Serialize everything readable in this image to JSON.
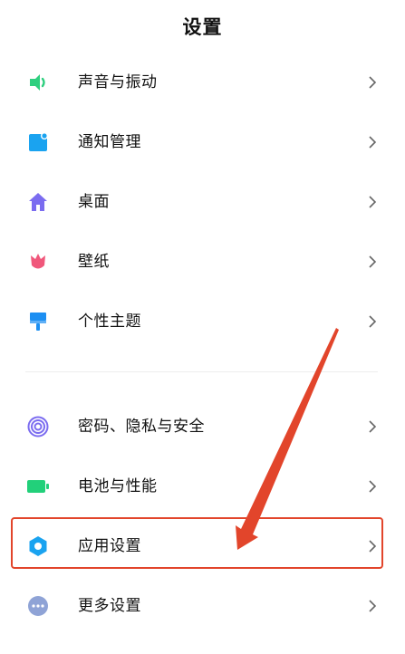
{
  "header": {
    "title": "设置"
  },
  "items": [
    {
      "label": "声音与振动",
      "icon": "speaker-icon",
      "color": "#2fcf7f"
    },
    {
      "label": "通知管理",
      "icon": "notification-icon",
      "color": "#1aa3f0"
    },
    {
      "label": "桌面",
      "icon": "home-icon",
      "color": "#7b6cf0"
    },
    {
      "label": "壁纸",
      "icon": "tulip-icon",
      "color": "#f0577b"
    },
    {
      "label": "个性主题",
      "icon": "paint-brush-icon",
      "color": "#1d8ff2"
    },
    {
      "label": "密码、隐私与安全",
      "icon": "fingerprint-icon",
      "color": "#7b6cf0"
    },
    {
      "label": "电池与性能",
      "icon": "battery-icon",
      "color": "#22d07a"
    },
    {
      "label": "应用设置",
      "icon": "gear-icon",
      "color": "#1aa3f0"
    },
    {
      "label": "更多设置",
      "icon": "more-dots-icon",
      "color": "#8fa3d6"
    }
  ],
  "annotation": {
    "highlight_color": "#e2452b",
    "highlighted_item": "应用设置"
  }
}
